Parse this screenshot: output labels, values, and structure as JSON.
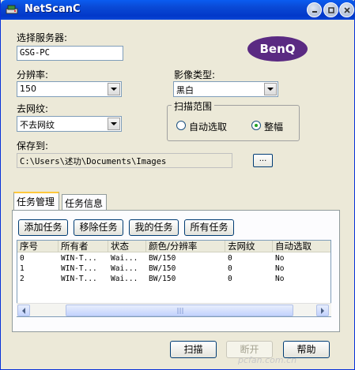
{
  "window": {
    "title": "NetScanC"
  },
  "server": {
    "label": "选择服务器:",
    "value": "GSG-PC"
  },
  "brand": {
    "logo_text": "BenQ",
    "color": "#5a2a82"
  },
  "resolution": {
    "label": "分辨率:",
    "value": "150"
  },
  "image_type": {
    "label": "影像类型:",
    "value": "黑白"
  },
  "descreen": {
    "label": "去网纹:",
    "value": "不去网纹"
  },
  "scan_area": {
    "title": "扫描范围",
    "options": [
      {
        "label": "自动选取",
        "selected": false
      },
      {
        "label": "整幅",
        "selected": true
      }
    ]
  },
  "save_to": {
    "label": "保存到:",
    "value": "C:\\Users\\述功\\Documents\\Images",
    "browse_label": "..."
  },
  "tabs": [
    {
      "label": "任务管理",
      "active": true
    },
    {
      "label": "任务信息",
      "active": false
    }
  ],
  "task_buttons": {
    "add": "添加任务",
    "remove": "移除任务",
    "mine": "我的任务",
    "all": "所有任务"
  },
  "table": {
    "columns": [
      "序号",
      "所有者",
      "状态",
      "颜色/分辨率",
      "去网纹",
      "自动选取"
    ],
    "rows": [
      [
        "0",
        "WIN-T...",
        "Wai...",
        "BW/150",
        "0",
        "No"
      ],
      [
        "1",
        "WIN-T...",
        "Wai...",
        "BW/150",
        "0",
        "No"
      ],
      [
        "2",
        "WIN-T...",
        "Wai...",
        "BW/150",
        "0",
        "No"
      ]
    ]
  },
  "footer_buttons": {
    "scan": "扫描",
    "disconnect": "断开",
    "help": "帮助"
  },
  "watermark": "pcfan.com.cn"
}
